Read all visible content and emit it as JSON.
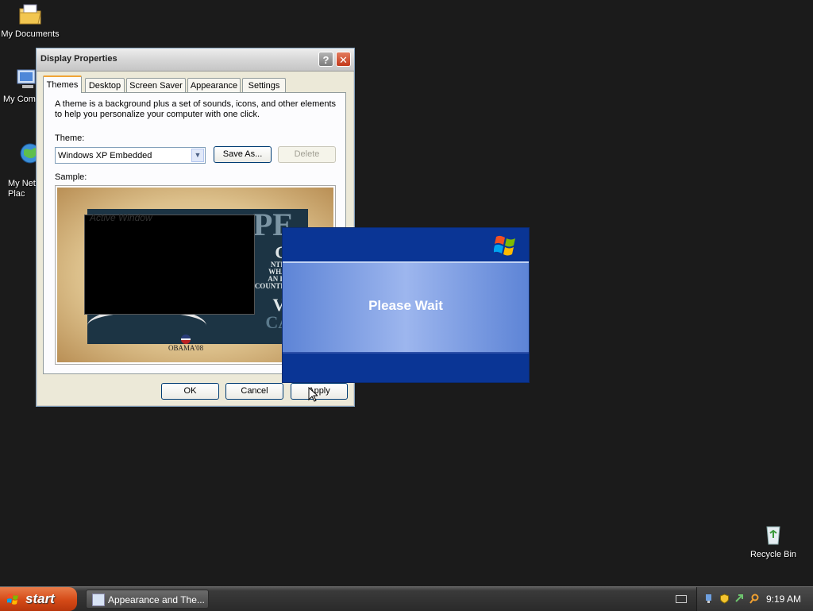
{
  "desktop": {
    "icons": [
      {
        "label": "My Documents"
      },
      {
        "label": "My Com"
      },
      {
        "label": "My Net\nPlac"
      },
      {
        "label": "Recycle Bin"
      }
    ]
  },
  "dialog": {
    "title": "Display Properties",
    "tabs": [
      "Themes",
      "Desktop",
      "Screen Saver",
      "Appearance",
      "Settings"
    ],
    "description": "A theme is a background plus a set of sounds, icons, and other elements to help you personalize your computer with one click.",
    "theme_label": "Theme:",
    "theme_value": "Windows XP Embedded",
    "save_as_label": "Save As...",
    "delete_label": "Delete",
    "sample_label": "Sample:",
    "sample_window_title": "Active Window",
    "sample_caption": "OBAMA'08",
    "ok_label": "OK",
    "cancel_label": "Cancel",
    "apply_label": "Apply"
  },
  "wait": {
    "message": "Please Wait"
  },
  "taskbar": {
    "start_label": "start",
    "task_label": "Appearance and The...",
    "clock": "9:19 AM"
  }
}
